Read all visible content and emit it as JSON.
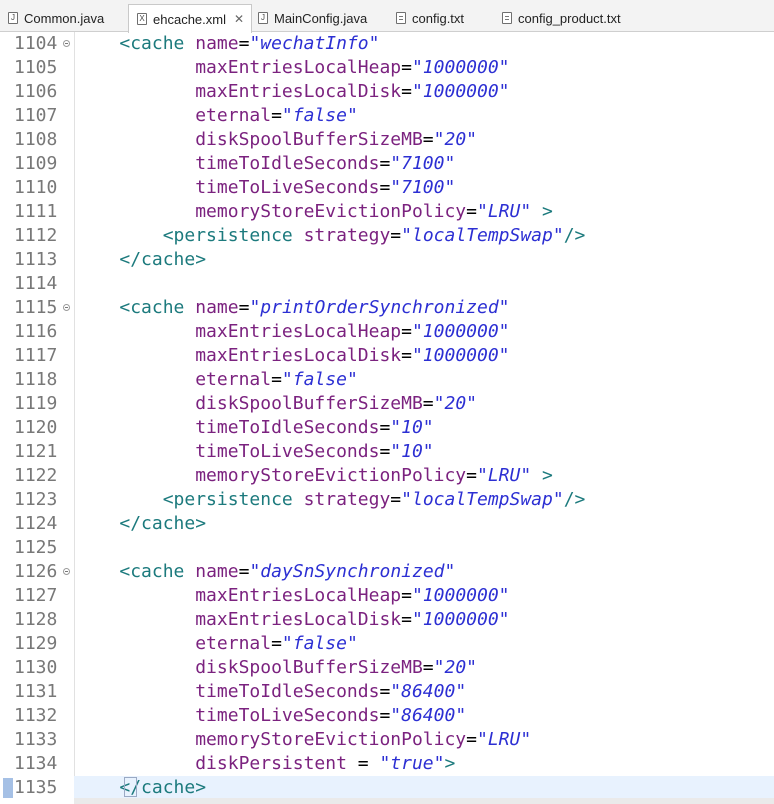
{
  "tabs": [
    {
      "label": "Common.java",
      "icon": "java-file-icon",
      "active": false
    },
    {
      "label": "ehcache.xml",
      "icon": "xml-file-icon",
      "active": true,
      "close": "✕"
    },
    {
      "label": "MainConfig.java",
      "icon": "java-file-icon",
      "active": false
    },
    {
      "label": "config.txt",
      "icon": "text-file-icon",
      "active": false
    },
    {
      "label": "config_product.txt",
      "icon": "text-file-icon",
      "active": false
    }
  ],
  "editor": {
    "current_line": "1135",
    "lines": [
      {
        "num": "1104",
        "fold": true,
        "tokens": [
          [
            "t",
            "    "
          ],
          [
            "tag",
            "<cache"
          ],
          [
            "t",
            " "
          ],
          [
            "attr",
            "name"
          ],
          [
            "t",
            "="
          ],
          [
            "str",
            "\"wechatInfo\""
          ]
        ]
      },
      {
        "num": "1105",
        "tokens": [
          [
            "t",
            "           "
          ],
          [
            "attr",
            "maxEntriesLocalHeap"
          ],
          [
            "t",
            "="
          ],
          [
            "str",
            "\"1000000\""
          ]
        ]
      },
      {
        "num": "1106",
        "tokens": [
          [
            "t",
            "           "
          ],
          [
            "attr",
            "maxEntriesLocalDisk"
          ],
          [
            "t",
            "="
          ],
          [
            "str",
            "\"1000000\""
          ]
        ]
      },
      {
        "num": "1107",
        "tokens": [
          [
            "t",
            "           "
          ],
          [
            "attr",
            "eternal"
          ],
          [
            "t",
            "="
          ],
          [
            "str",
            "\"false\""
          ]
        ]
      },
      {
        "num": "1108",
        "tokens": [
          [
            "t",
            "           "
          ],
          [
            "attr",
            "diskSpoolBufferSizeMB"
          ],
          [
            "t",
            "="
          ],
          [
            "str",
            "\"20\""
          ]
        ]
      },
      {
        "num": "1109",
        "tokens": [
          [
            "t",
            "           "
          ],
          [
            "attr",
            "timeToIdleSeconds"
          ],
          [
            "t",
            "="
          ],
          [
            "str",
            "\"7100\""
          ]
        ]
      },
      {
        "num": "1110",
        "tokens": [
          [
            "t",
            "           "
          ],
          [
            "attr",
            "timeToLiveSeconds"
          ],
          [
            "t",
            "="
          ],
          [
            "str",
            "\"7100\""
          ]
        ]
      },
      {
        "num": "1111",
        "tokens": [
          [
            "t",
            "           "
          ],
          [
            "attr",
            "memoryStoreEvictionPolicy"
          ],
          [
            "t",
            "="
          ],
          [
            "str",
            "\"LRU\""
          ],
          [
            "t",
            " "
          ],
          [
            "tag",
            ">"
          ]
        ]
      },
      {
        "num": "1112",
        "tokens": [
          [
            "t",
            "        "
          ],
          [
            "tag",
            "<persistence"
          ],
          [
            "t",
            " "
          ],
          [
            "attr",
            "strategy"
          ],
          [
            "t",
            "="
          ],
          [
            "str",
            "\"localTempSwap\""
          ],
          [
            "tag",
            "/>"
          ]
        ]
      },
      {
        "num": "1113",
        "tokens": [
          [
            "t",
            "    "
          ],
          [
            "tag",
            "</cache>"
          ]
        ]
      },
      {
        "num": "1114",
        "tokens": []
      },
      {
        "num": "1115",
        "fold": true,
        "tokens": [
          [
            "t",
            "    "
          ],
          [
            "tag",
            "<cache"
          ],
          [
            "t",
            " "
          ],
          [
            "attr",
            "name"
          ],
          [
            "t",
            "="
          ],
          [
            "str",
            "\"printOrderSynchronized\""
          ]
        ]
      },
      {
        "num": "1116",
        "tokens": [
          [
            "t",
            "           "
          ],
          [
            "attr",
            "maxEntriesLocalHeap"
          ],
          [
            "t",
            "="
          ],
          [
            "str",
            "\"1000000\""
          ]
        ]
      },
      {
        "num": "1117",
        "tokens": [
          [
            "t",
            "           "
          ],
          [
            "attr",
            "maxEntriesLocalDisk"
          ],
          [
            "t",
            "="
          ],
          [
            "str",
            "\"1000000\""
          ]
        ]
      },
      {
        "num": "1118",
        "tokens": [
          [
            "t",
            "           "
          ],
          [
            "attr",
            "eternal"
          ],
          [
            "t",
            "="
          ],
          [
            "str",
            "\"false\""
          ]
        ]
      },
      {
        "num": "1119",
        "tokens": [
          [
            "t",
            "           "
          ],
          [
            "attr",
            "diskSpoolBufferSizeMB"
          ],
          [
            "t",
            "="
          ],
          [
            "str",
            "\"20\""
          ]
        ]
      },
      {
        "num": "1120",
        "tokens": [
          [
            "t",
            "           "
          ],
          [
            "attr",
            "timeToIdleSeconds"
          ],
          [
            "t",
            "="
          ],
          [
            "str",
            "\"10\""
          ]
        ]
      },
      {
        "num": "1121",
        "tokens": [
          [
            "t",
            "           "
          ],
          [
            "attr",
            "timeToLiveSeconds"
          ],
          [
            "t",
            "="
          ],
          [
            "str",
            "\"10\""
          ]
        ]
      },
      {
        "num": "1122",
        "tokens": [
          [
            "t",
            "           "
          ],
          [
            "attr",
            "memoryStoreEvictionPolicy"
          ],
          [
            "t",
            "="
          ],
          [
            "str",
            "\"LRU\""
          ],
          [
            "t",
            " "
          ],
          [
            "tag",
            ">"
          ]
        ]
      },
      {
        "num": "1123",
        "tokens": [
          [
            "t",
            "        "
          ],
          [
            "tag",
            "<persistence"
          ],
          [
            "t",
            " "
          ],
          [
            "attr",
            "strategy"
          ],
          [
            "t",
            "="
          ],
          [
            "str",
            "\"localTempSwap\""
          ],
          [
            "tag",
            "/>"
          ]
        ]
      },
      {
        "num": "1124",
        "tokens": [
          [
            "t",
            "    "
          ],
          [
            "tag",
            "</cache>"
          ]
        ]
      },
      {
        "num": "1125",
        "tokens": []
      },
      {
        "num": "1126",
        "fold": true,
        "tokens": [
          [
            "t",
            "    "
          ],
          [
            "tag",
            "<cache"
          ],
          [
            "t",
            " "
          ],
          [
            "attr",
            "name"
          ],
          [
            "t",
            "="
          ],
          [
            "str",
            "\"daySnSynchronized\""
          ]
        ]
      },
      {
        "num": "1127",
        "tokens": [
          [
            "t",
            "           "
          ],
          [
            "attr",
            "maxEntriesLocalHeap"
          ],
          [
            "t",
            "="
          ],
          [
            "str",
            "\"1000000\""
          ]
        ]
      },
      {
        "num": "1128",
        "tokens": [
          [
            "t",
            "           "
          ],
          [
            "attr",
            "maxEntriesLocalDisk"
          ],
          [
            "t",
            "="
          ],
          [
            "str",
            "\"1000000\""
          ]
        ]
      },
      {
        "num": "1129",
        "tokens": [
          [
            "t",
            "           "
          ],
          [
            "attr",
            "eternal"
          ],
          [
            "t",
            "="
          ],
          [
            "str",
            "\"false\""
          ]
        ]
      },
      {
        "num": "1130",
        "tokens": [
          [
            "t",
            "           "
          ],
          [
            "attr",
            "diskSpoolBufferSizeMB"
          ],
          [
            "t",
            "="
          ],
          [
            "str",
            "\"20\""
          ]
        ]
      },
      {
        "num": "1131",
        "tokens": [
          [
            "t",
            "           "
          ],
          [
            "attr",
            "timeToIdleSeconds"
          ],
          [
            "t",
            "="
          ],
          [
            "str",
            "\"86400\""
          ]
        ]
      },
      {
        "num": "1132",
        "tokens": [
          [
            "t",
            "           "
          ],
          [
            "attr",
            "timeToLiveSeconds"
          ],
          [
            "t",
            "="
          ],
          [
            "str",
            "\"86400\""
          ]
        ]
      },
      {
        "num": "1133",
        "tokens": [
          [
            "t",
            "           "
          ],
          [
            "attr",
            "memoryStoreEvictionPolicy"
          ],
          [
            "t",
            "="
          ],
          [
            "str",
            "\"LRU\""
          ]
        ]
      },
      {
        "num": "1134",
        "tokens": [
          [
            "t",
            "           "
          ],
          [
            "attr",
            "diskPersistent"
          ],
          [
            "t",
            " = "
          ],
          [
            "str",
            "\"true\""
          ],
          [
            "tag",
            ">"
          ]
        ]
      },
      {
        "num": "1135",
        "tokens": [
          [
            "t",
            "    "
          ],
          [
            "tag",
            "</cache>"
          ]
        ]
      }
    ]
  }
}
